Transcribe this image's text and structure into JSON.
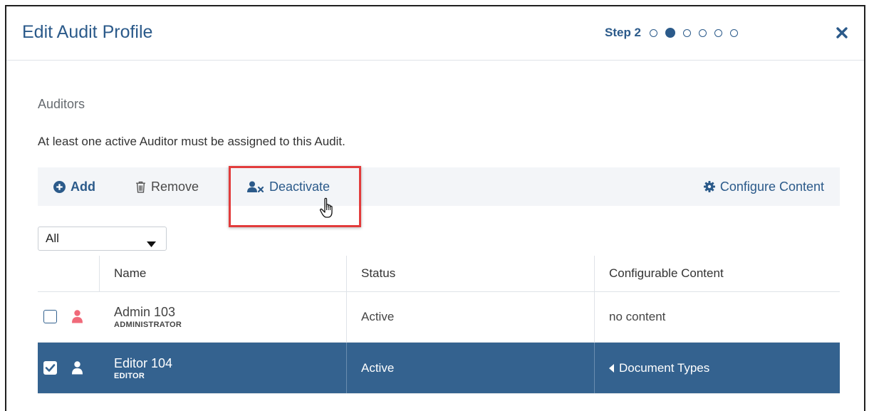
{
  "dialog": {
    "title": "Edit Audit Profile",
    "step_label": "Step 2",
    "steps_total": 6,
    "current_step": 2
  },
  "section": {
    "title": "Auditors",
    "description": "At least one active Auditor must be assigned to this Audit."
  },
  "toolbar": {
    "add_label": "Add",
    "remove_label": "Remove",
    "deactivate_label": "Deactivate",
    "configure_label": "Configure Content"
  },
  "filter": {
    "selected": "All"
  },
  "table": {
    "headers": [
      "Name",
      "Status",
      "Configurable Content"
    ],
    "rows": [
      {
        "name": "Admin 103",
        "role": "ADMINISTRATOR",
        "status": "Active",
        "content": "no content",
        "checked": false
      },
      {
        "name": "Editor 104",
        "role": "EDITOR",
        "status": "Active",
        "content": "Document Types",
        "checked": true
      }
    ]
  },
  "colors": {
    "accent": "#2b5a8a",
    "selected_row": "#34628f",
    "highlight_box": "#e23c3c",
    "admin_icon": "#f06a7a"
  }
}
